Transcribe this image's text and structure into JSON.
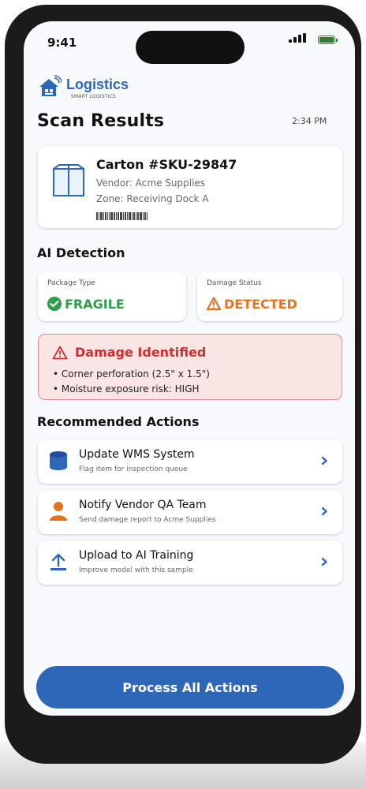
{
  "status_bar": {
    "time": "9:41"
  },
  "brand": {
    "name": "Logistics",
    "tagline": "SMART LOGISTICS"
  },
  "header": {
    "title": "Scan Results",
    "time": "2:34 PM"
  },
  "carton": {
    "title": "Carton #SKU-29847",
    "vendor": "Vendor: Acme Supplies",
    "zone": "Zone: Receiving Dock A"
  },
  "ai_detection": {
    "heading": "AI Detection",
    "package_type": {
      "label": "Package Type",
      "value": "FRAGILE",
      "color": "#2e9e4a"
    },
    "damage_status": {
      "label": "Damage Status",
      "value": "DETECTED",
      "color": "#e8711c"
    }
  },
  "damage": {
    "title": "Damage Identified",
    "items": [
      "• Corner perforation (2.5\" x 1.5\")",
      "• Moisture exposure risk: HIGH"
    ]
  },
  "actions": {
    "heading": "Recommended Actions",
    "items": [
      {
        "title": "Update WMS System",
        "subtitle": "Flag item for inspection queue",
        "icon": "database-icon"
      },
      {
        "title": "Notify Vendor QA Team",
        "subtitle": "Send damage report to Acme Supplies",
        "icon": "person-icon"
      },
      {
        "title": "Upload to AI Training",
        "subtitle": "Improve model with this sample",
        "icon": "upload-icon"
      }
    ]
  },
  "process_button": {
    "label": "Process All Actions"
  },
  "colors": {
    "brand": "#2f67b8",
    "danger": "#cf2e2e",
    "danger_bg": "#fbe4e4",
    "success": "#2e9e4a",
    "warning": "#e8711c"
  }
}
